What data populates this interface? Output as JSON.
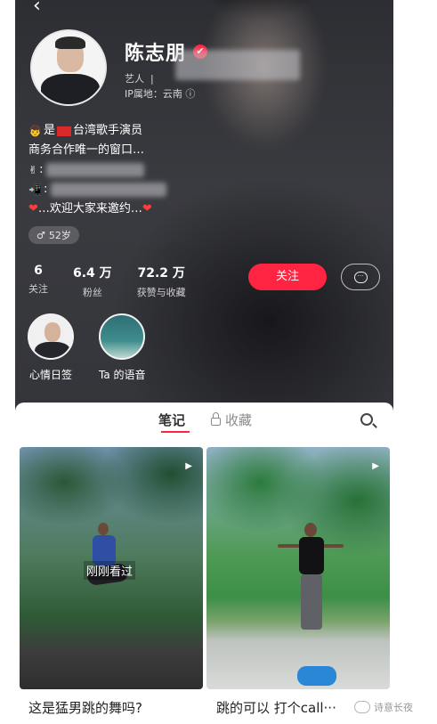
{
  "profile": {
    "name": "陈志朋",
    "role_label": "艺人",
    "role_tail": "|",
    "ip_label": "IP属地：云南",
    "bio": {
      "line1_pre": "是",
      "line1_post": "台湾歌手演员",
      "line2": "商务合作唯一的窗口…",
      "line5": "…欢迎大家来邀约…"
    },
    "age": "52岁"
  },
  "stats": [
    {
      "num": "6",
      "label": "关注"
    },
    {
      "num": "6.4 万",
      "label": "粉丝"
    },
    {
      "num": "72.2 万",
      "label": "获赞与收藏"
    }
  ],
  "actions": {
    "follow": "关注"
  },
  "collections": [
    {
      "label": "心情日签"
    },
    {
      "label": "Ta 的语音"
    }
  ],
  "tabs": {
    "notes": "笔记",
    "favorites": "收藏"
  },
  "cards": [
    {
      "title": "这是猛男跳的舞吗?",
      "overlay": "刚刚看过"
    },
    {
      "title": "跳的可以 打个call···"
    }
  ],
  "watermark": "诗意长夜"
}
